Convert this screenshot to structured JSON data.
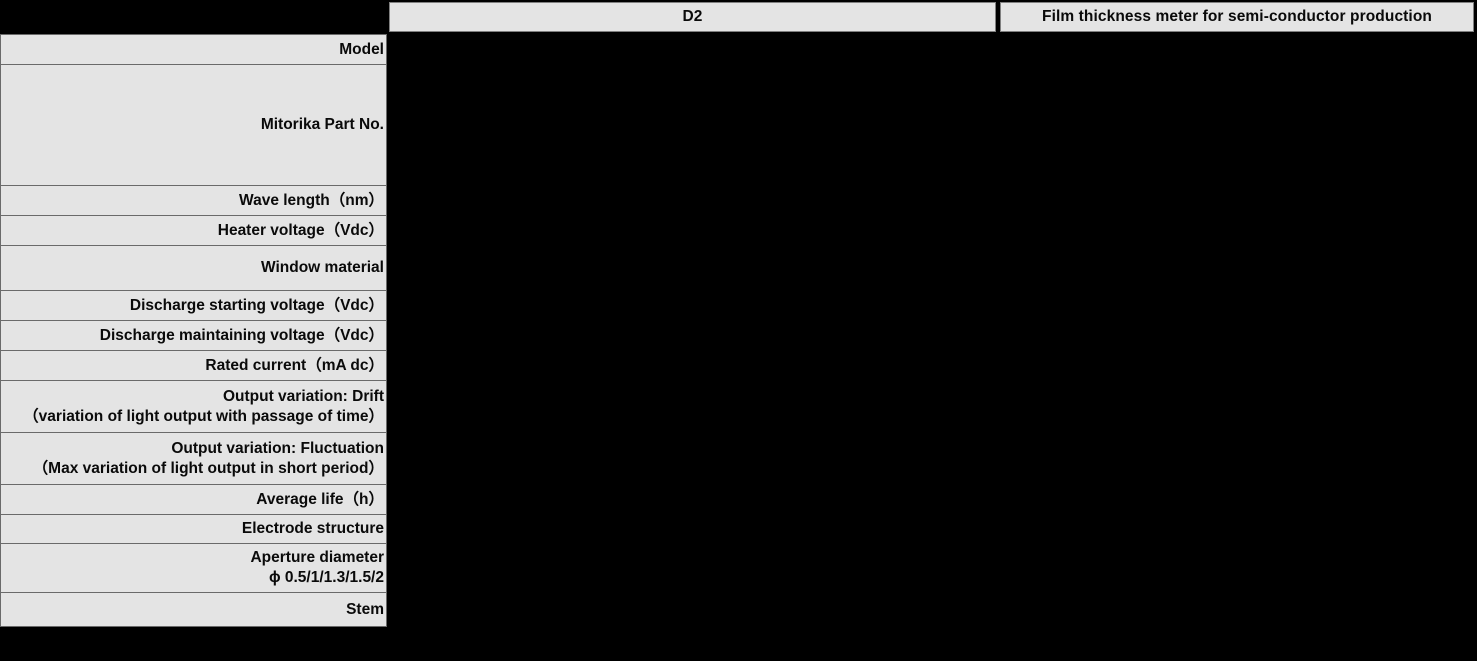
{
  "table": {
    "header": {
      "model_label": "D2",
      "application_label": "Film thickness meter for semi-conductor production"
    },
    "colors": {
      "cell_background": "#e4e4e4",
      "page_background": "#000000",
      "text": "#0a0a0a",
      "border": "#6a6a6a"
    },
    "rows": [
      {
        "label": "Model",
        "label2": "",
        "height": 31
      },
      {
        "label": "Mitorika Part No.",
        "label2": "",
        "height": 121
      },
      {
        "label": "Wave length（nm）",
        "label2": "",
        "height": 30
      },
      {
        "label": "Heater voltage（Vdc）",
        "label2": "",
        "height": 30
      },
      {
        "label": "Window material",
        "label2": "",
        "height": 45
      },
      {
        "label": "Discharge starting voltage（Vdc）",
        "label2": "",
        "height": 30
      },
      {
        "label": "Discharge maintaining voltage（Vdc）",
        "label2": "",
        "height": 30
      },
      {
        "label": "Rated current（mA dc）",
        "label2": "",
        "height": 30
      },
      {
        "label": "Output variation: Drift",
        "label2": "（variation of light output with passage of time）",
        "height": 52
      },
      {
        "label": "Output variation: Fluctuation",
        "label2": "（Max variation of light output in short period）",
        "height": 52
      },
      {
        "label": "Average life（h）",
        "label2": "",
        "height": 30
      },
      {
        "label": "Electrode structure",
        "label2": "",
        "height": 29
      },
      {
        "label": "Aperture diameter",
        "label2": "ϕ 0.5/1/1.3/1.5/2",
        "height": 49
      },
      {
        "label": "Stem",
        "label2": "",
        "height": 34
      }
    ]
  }
}
